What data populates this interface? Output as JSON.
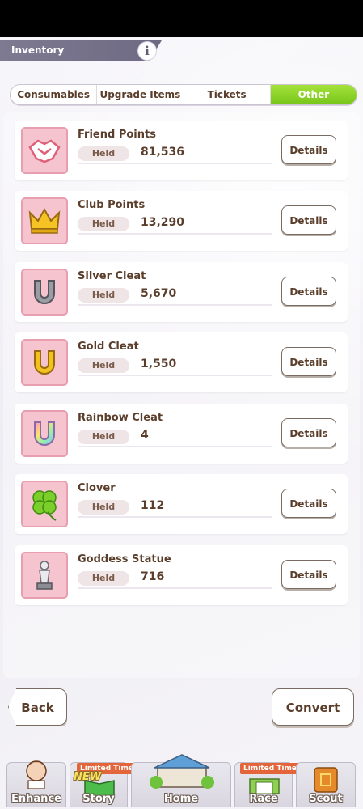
{
  "header": {
    "title": "Inventory",
    "info_icon": "info-icon"
  },
  "tabs": [
    {
      "label": "Consumables",
      "active": false
    },
    {
      "label": "Upgrade Items",
      "active": false
    },
    {
      "label": "Tickets",
      "active": false
    },
    {
      "label": "Other",
      "active": true
    }
  ],
  "items": [
    {
      "name": "Friend Points",
      "held_label": "Held",
      "value": "81,536",
      "details_label": "Details",
      "icon": "handshake-icon"
    },
    {
      "name": "Club Points",
      "held_label": "Held",
      "value": "13,290",
      "details_label": "Details",
      "icon": "crown-icon"
    },
    {
      "name": "Silver Cleat",
      "held_label": "Held",
      "value": "5,670",
      "details_label": "Details",
      "icon": "silver-horseshoe-icon"
    },
    {
      "name": "Gold Cleat",
      "held_label": "Held",
      "value": "1,550",
      "details_label": "Details",
      "icon": "gold-horseshoe-icon"
    },
    {
      "name": "Rainbow Cleat",
      "held_label": "Held",
      "value": "4",
      "details_label": "Details",
      "icon": "rainbow-horseshoe-icon"
    },
    {
      "name": "Clover",
      "held_label": "Held",
      "value": "112",
      "details_label": "Details",
      "icon": "clover-icon"
    },
    {
      "name": "Goddess Statue",
      "held_label": "Held",
      "value": "716",
      "details_label": "Details",
      "icon": "statue-icon"
    }
  ],
  "footer": {
    "back_label": "Back",
    "convert_label": "Convert"
  },
  "bottom_nav": [
    {
      "label": "Enhance",
      "badge": ""
    },
    {
      "label": "Story",
      "badge": "Limited Time",
      "new": "NEW"
    },
    {
      "label": "Home",
      "badge": ""
    },
    {
      "label": "Race",
      "badge": "Limited Time"
    },
    {
      "label": "Scout",
      "badge": ""
    }
  ],
  "colors": {
    "active_tab": "#86cf25",
    "item_icon_bg": "#f5c4cf",
    "header_bar": "#7e7a92"
  }
}
